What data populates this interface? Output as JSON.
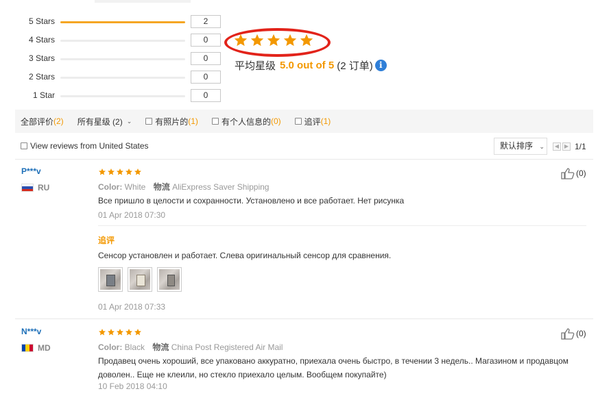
{
  "histogram": [
    {
      "label": "5 Stars",
      "count": "2",
      "fraction": 1.0
    },
    {
      "label": "4 Stars",
      "count": "0",
      "fraction": 0
    },
    {
      "label": "3 Stars",
      "count": "0",
      "fraction": 0
    },
    {
      "label": "2 Stars",
      "count": "0",
      "fraction": 0
    },
    {
      "label": "1 Star",
      "count": "0",
      "fraction": 0
    }
  ],
  "average": {
    "label": "平均星级",
    "value": "5.0 out of 5",
    "orders": "(2 订单)",
    "stars": 5,
    "info_icon": "info-icon"
  },
  "filters": {
    "all_label": "全部评价",
    "all_count": "(2)",
    "stars_label": "所有星级 (2)",
    "photos_label": "有照片的",
    "photos_count": "(1)",
    "personal_label": "有个人信息的",
    "personal_count": "(0)",
    "followup_label": "追评",
    "followup_count": "(1)"
  },
  "us_reviews_label": "View reviews from United States",
  "sort_label": "默认排序",
  "pagination": "1/1",
  "reviews": [
    {
      "name": "P***v",
      "country": "RU",
      "stars": 5,
      "color_label": "Color:",
      "color_value": "White",
      "shipping_label": "物流",
      "shipping_value": "AliExpress Saver Shipping",
      "text": "Все пришло в целости и сохранности. Установлено и все работает. Нет рисунка",
      "date": "01 Apr 2018 07:30",
      "followup_title": "追评",
      "followup_text": "Сенсор установлен и работает. Слева оригинальный сенсор для сравнения.",
      "followup_date": "01 Apr 2018 07:33",
      "helpful": "(0)"
    },
    {
      "name": "N***v",
      "country": "MD",
      "stars": 5,
      "color_label": "Color:",
      "color_value": "Black",
      "shipping_label": "物流",
      "shipping_value": "China Post Registered Air Mail",
      "text": "Продавец очень хороший, все упаковано аккуратно, приехала очень быстро, в течении 3 недель.. Магазином и продавцом доволен.. Еще не клеили, но стекло приехало целым. Вообщем покупайте)",
      "date": "10 Feb 2018 04:10",
      "helpful": "(0)"
    }
  ],
  "colors": {
    "accent": "#f39800",
    "bar": "#f5a623",
    "name_link": "#1d6fb8",
    "highlight_circle": "#e2231a",
    "info": "#2f7fd8"
  }
}
